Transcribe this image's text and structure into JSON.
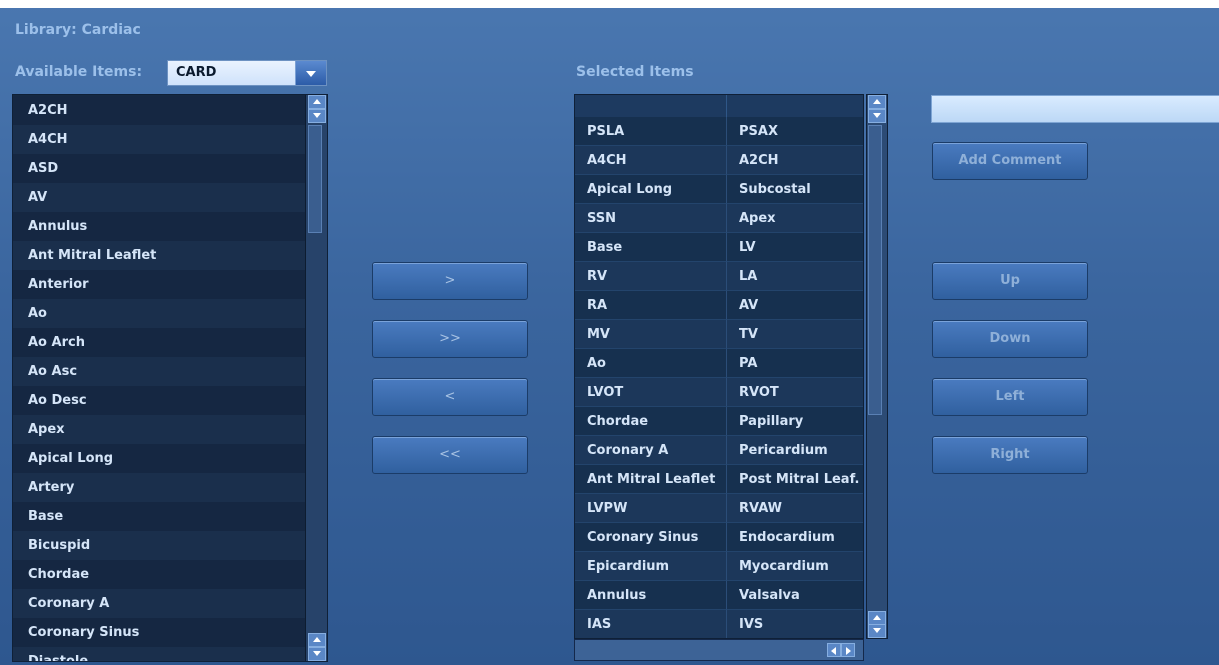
{
  "library_title": "Library: Cardiac",
  "available": {
    "label": "Available Items:",
    "combo_value": "CARD",
    "items": [
      "A2CH",
      "A4CH",
      "ASD",
      "AV",
      "Annulus",
      "Ant Mitral Leaflet",
      "Anterior",
      "Ao",
      "Ao Arch",
      "Ao Asc",
      "Ao Desc",
      "Apex",
      "Apical Long",
      "Artery",
      "Base",
      "Bicuspid",
      "Chordae",
      "Coronary A",
      "Coronary Sinus",
      "Diastole"
    ]
  },
  "transfer_buttons": [
    ">",
    ">>",
    "<",
    "<<"
  ],
  "selected": {
    "label": "Selected Items",
    "rows": [
      [
        "PSLA",
        "PSAX"
      ],
      [
        "A4CH",
        "A2CH"
      ],
      [
        "Apical Long",
        "Subcostal"
      ],
      [
        "SSN",
        "Apex"
      ],
      [
        "Base",
        "LV"
      ],
      [
        "RV",
        "LA"
      ],
      [
        "RA",
        "AV"
      ],
      [
        "MV",
        "TV"
      ],
      [
        "Ao",
        "PA"
      ],
      [
        "LVOT",
        "RVOT"
      ],
      [
        "Chordae",
        "Papillary"
      ],
      [
        "Coronary A",
        "Pericardium"
      ],
      [
        "Ant Mitral Leaflet",
        "Post Mitral Leaf."
      ],
      [
        "LVPW",
        "RVAW"
      ],
      [
        "Coronary Sinus",
        "Endocardium"
      ],
      [
        "Epicardium",
        "Myocardium"
      ],
      [
        "Annulus",
        "Valsalva"
      ],
      [
        "IAS",
        "IVS"
      ]
    ]
  },
  "comment": {
    "value": "",
    "add_label": "Add Comment"
  },
  "move_buttons": [
    "Up",
    "Down",
    "Left",
    "Right"
  ]
}
